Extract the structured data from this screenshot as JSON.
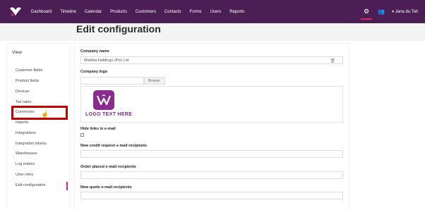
{
  "nav": {
    "items": [
      "Dashboard",
      "Timeline",
      "Calendar",
      "Products",
      "Customers",
      "Contacts",
      "Forms",
      "Users",
      "Reports"
    ],
    "user_name": "▾ Jana du Toit",
    "gear_icon": "gear-icon",
    "users_icon": "users-icon"
  },
  "page": {
    "title": "Edit configuration"
  },
  "sidebar": {
    "title": "View",
    "items": [
      "Customer fields",
      "Product fields",
      "Devices",
      "Tax rates",
      "Currencies",
      "Imports",
      "Integrations",
      "Integration tokens",
      "Warehouses",
      "Log entries",
      "User roles",
      "Edit configuration"
    ],
    "active": "Edit configuration",
    "highlighted": "Currencies"
  },
  "form": {
    "company_name_label": "Company name",
    "company_name_value": "Mamba Holdings (Pty) Ltd",
    "company_logo_label": "Company logo",
    "browse_label": "Browse",
    "logo_text": "LOGO TEXT HERE",
    "hide_links_label": "Hide links in e-mail",
    "credit_label": "New credit request e-mail recipients",
    "order_label": "Order placed e-mail recipients",
    "quote_label": "New quote e-mail recipients"
  },
  "colors": {
    "nav_bg": "#4b1f55",
    "accent": "#c42a86",
    "highlight": "#c00000"
  }
}
